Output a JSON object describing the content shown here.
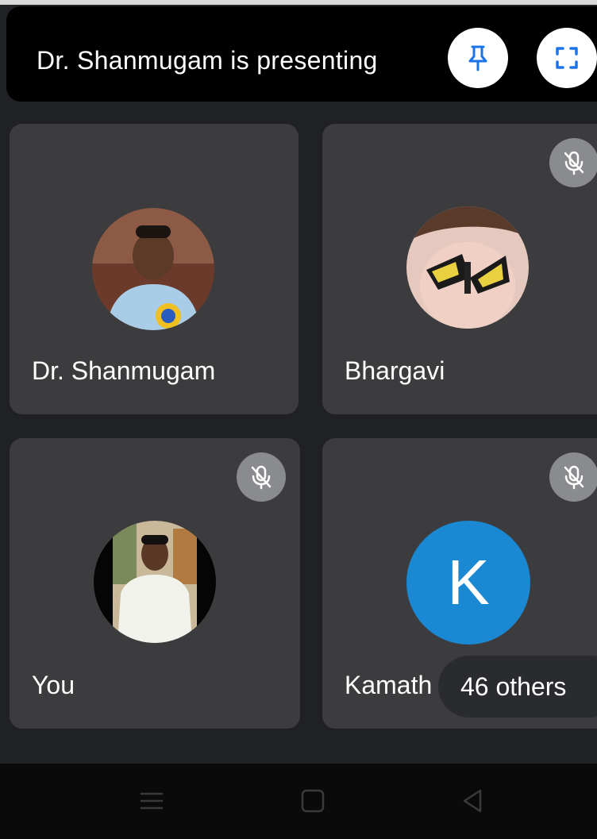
{
  "banner": {
    "presenting_text": "Dr. Shanmugam is presenting",
    "pin_icon": "pin-icon",
    "fullscreen_icon": "fullscreen-icon"
  },
  "participants": [
    {
      "name": "Dr. Shanmugam",
      "avatar": "photo",
      "muted": false
    },
    {
      "name": "Bhargavi",
      "avatar": "photo",
      "muted": true
    },
    {
      "name": "You",
      "avatar": "photo",
      "muted": true
    },
    {
      "name": "Kamath",
      "avatar_letter": "K",
      "avatar_color": "#1a88d3",
      "muted": true
    }
  ],
  "others": {
    "label": "46 others"
  },
  "colors": {
    "background": "#202124",
    "tile": "#3c3c3f",
    "banner": "#000000",
    "mute_badge": "#8a8b8e",
    "letter_avatar": "#1a88d3"
  },
  "navbar": {
    "recents_icon": "recents-icon",
    "home_icon": "home-icon",
    "back_icon": "back-icon"
  }
}
